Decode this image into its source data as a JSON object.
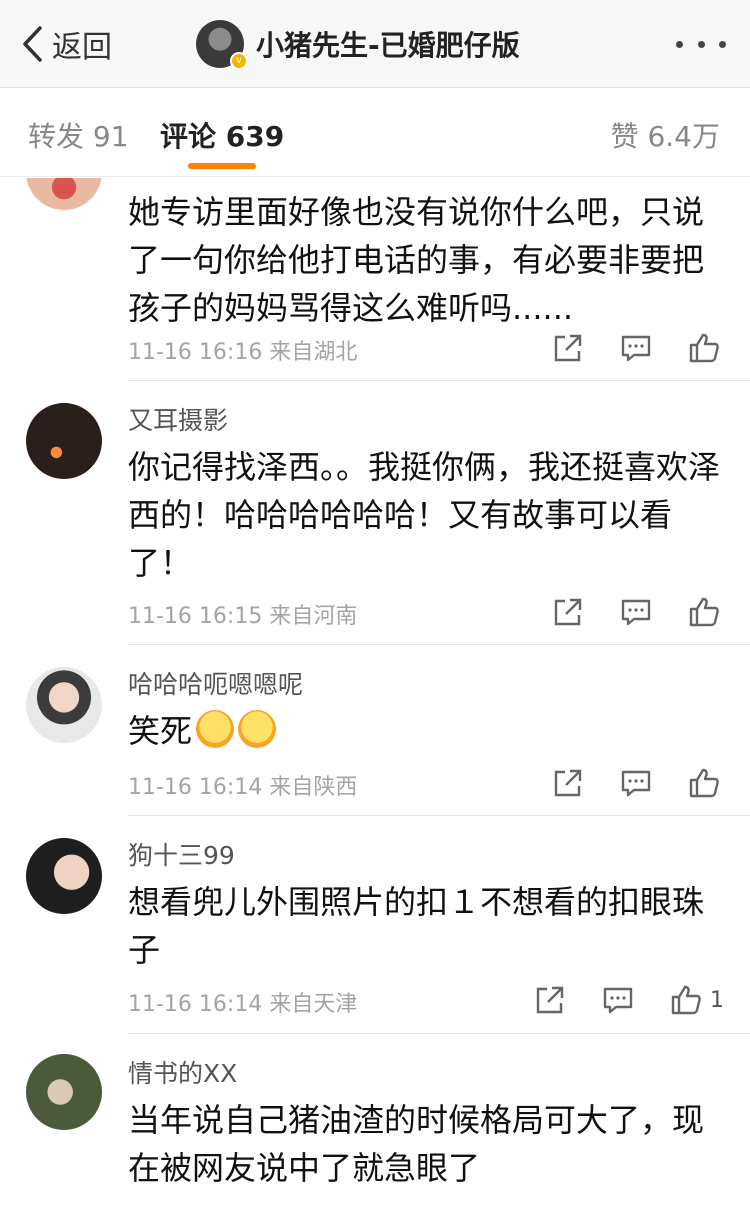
{
  "nav": {
    "back_label": "返回",
    "title": "小猪先生-已婚肥仔版"
  },
  "tabs": {
    "repost": "转发 91",
    "comment": "评论 639",
    "like": "赞 6.4万"
  },
  "comments": [
    {
      "name": "",
      "text": "她专访里面好像也没有说你什么吧，只说了一句你给他打电话的事，有必要非要把孩子的妈妈骂得这么难听吗......",
      "meta": "11-16 16:16 来自湖北",
      "likes": ""
    },
    {
      "name": "又耳摄影",
      "text": "你记得找泽西。。我挺你俩，我还挺喜欢泽西的！哈哈哈哈哈哈！又有故事可以看了！",
      "meta": "11-16 16:15 来自河南",
      "likes": ""
    },
    {
      "name": "哈哈哈呃嗯嗯呢",
      "text": "笑死",
      "meta": "11-16 16:14 来自陕西",
      "likes": ""
    },
    {
      "name": "狗十三99",
      "text": "想看兜儿外围照片的扣１不想看的扣眼珠子",
      "meta": "11-16 16:14 来自天津",
      "likes": "1"
    },
    {
      "name": "情书的XX",
      "text": "当年说自己猪油渣的时候格局可大了，现在被网友说中了就急眼了",
      "meta": "",
      "likes": ""
    }
  ],
  "icons": {
    "back": "chevron-left-icon",
    "more": "more-dots-icon",
    "share": "share-icon",
    "reply": "comment-icon",
    "like": "thumbs-up-icon",
    "emoji": "laughing-emoji-icon"
  },
  "colors": {
    "accent": "#ff8200",
    "meta": "#a4a4a4",
    "verified": "#f5b400"
  }
}
